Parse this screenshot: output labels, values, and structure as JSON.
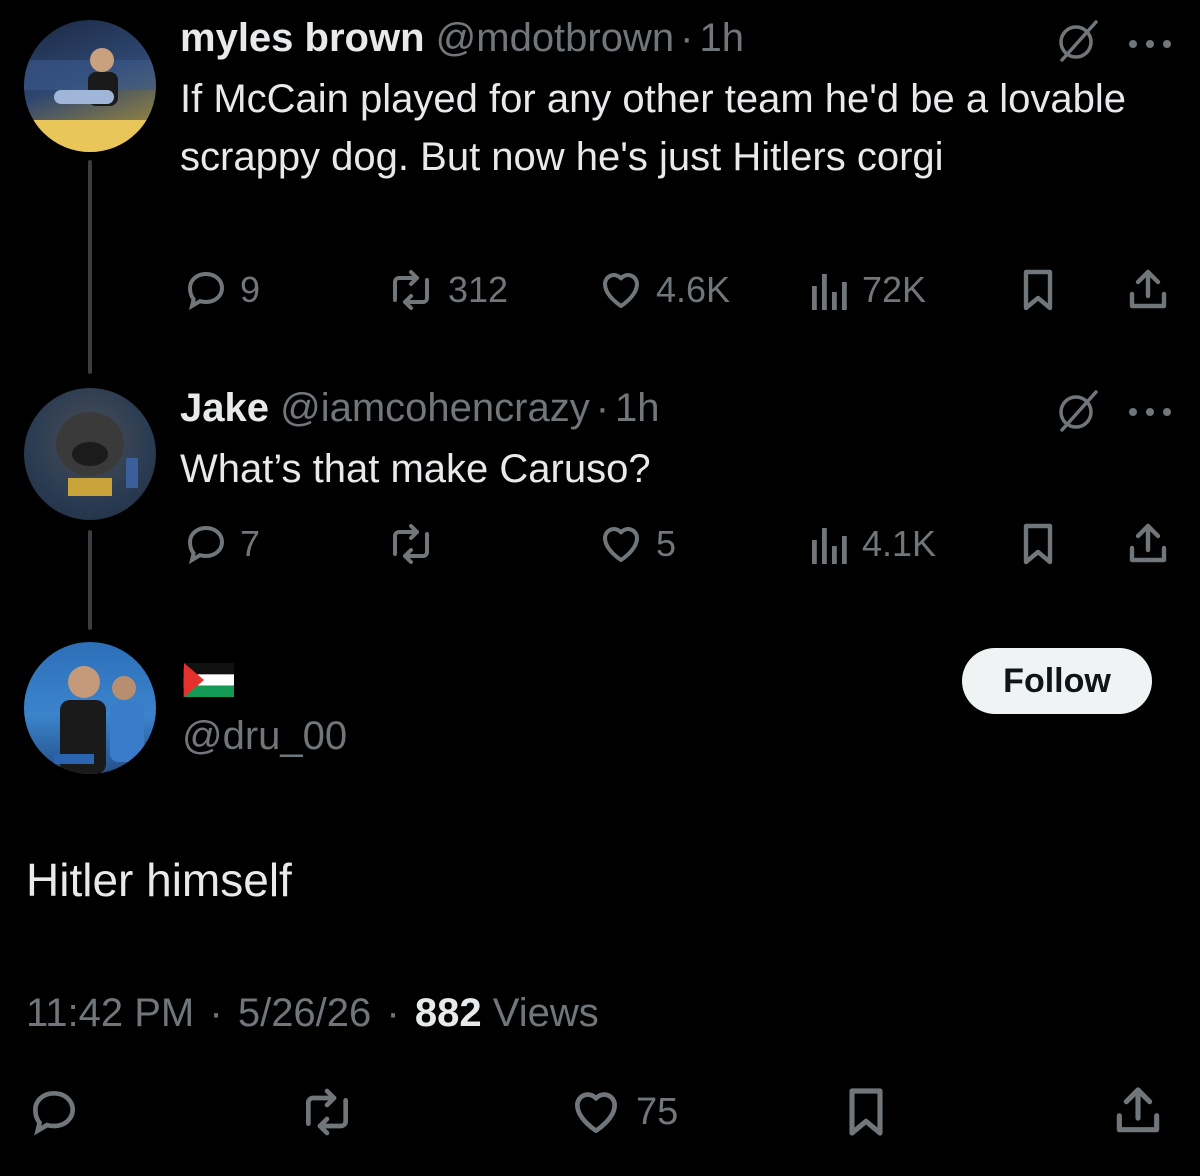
{
  "thread": [
    {
      "display_name": "myles brown",
      "handle": "@mdotbrown",
      "time": "1h",
      "text": "If McCain played for any other team he'd be a lovable scrappy dog. But now he's just Hitlers corgi",
      "stats": {
        "replies": "9",
        "reposts": "312",
        "likes": "4.6K",
        "views": "72K"
      }
    },
    {
      "display_name": "Jake",
      "handle": "@iamcohencrazy",
      "time": "1h",
      "text": "What’s that make Caruso?",
      "stats": {
        "replies": "7",
        "reposts": "",
        "likes": "5",
        "views": "4.1K"
      }
    }
  ],
  "main_post": {
    "display_name_flag": "🇵🇸",
    "handle": "@dru_00",
    "follow_label": "Follow",
    "text": "Hitler himself",
    "time": "11:42 PM",
    "date": "5/26/26",
    "views_count": "882",
    "views_label": "Views",
    "likes": "75",
    "separator": "·"
  },
  "colors": {
    "background": "#000000",
    "text": "#e7e9ea",
    "muted": "#71767b",
    "follow_button_bg": "#eff3f4",
    "thread_line": "#3a3d41"
  }
}
